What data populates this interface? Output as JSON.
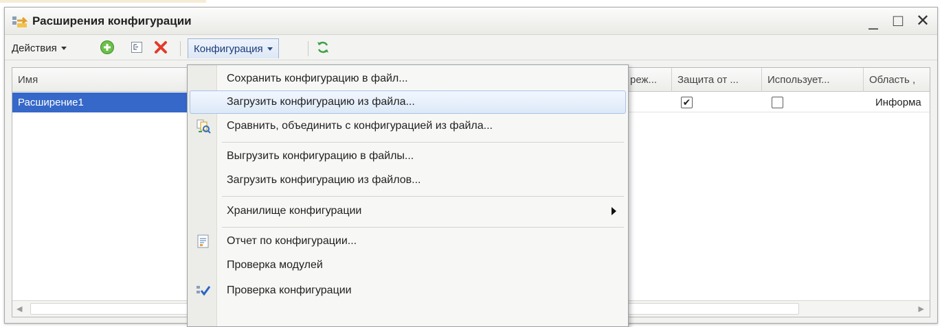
{
  "window": {
    "title": "Расширения конфигурации",
    "controls": {
      "minimize": "_",
      "maximize": "□",
      "close": "✕"
    }
  },
  "toolbar": {
    "actions_label": "Действия",
    "config_label": "Конфигурация",
    "icons": [
      "add-green-circle-icon",
      "tree-view-icon",
      "delete-red-x-icon",
      "refresh-icon"
    ]
  },
  "grid": {
    "columns": [
      "Имя",
      "реж...",
      "Защита от ...",
      "Использует...",
      "Область ,"
    ],
    "rows": [
      {
        "name": "Расширение1",
        "protect": true,
        "uses": false,
        "area": "Информа"
      }
    ]
  },
  "menu": {
    "items": [
      {
        "label": "Сохранить конфигурацию в файл..."
      },
      {
        "label": "Загрузить конфигурацию из файла..."
      },
      {
        "label": "Сравнить, объединить с конфигурацией из файла..."
      },
      {
        "label": "Выгрузить конфигурацию в файлы..."
      },
      {
        "label": "Загрузить конфигурацию из файлов..."
      },
      {
        "label": "Хранилище конфигурации"
      },
      {
        "label": "Отчет по конфигурации..."
      },
      {
        "label": "Проверка модулей"
      },
      {
        "label": "Проверка конфигурации"
      }
    ],
    "hovered_item": "Загрузить конфигурацию из файла..."
  },
  "colors": {
    "selection": "#3568c8",
    "menu_hover": "#dde9f8",
    "toolbar_active": "#dde8f6"
  }
}
